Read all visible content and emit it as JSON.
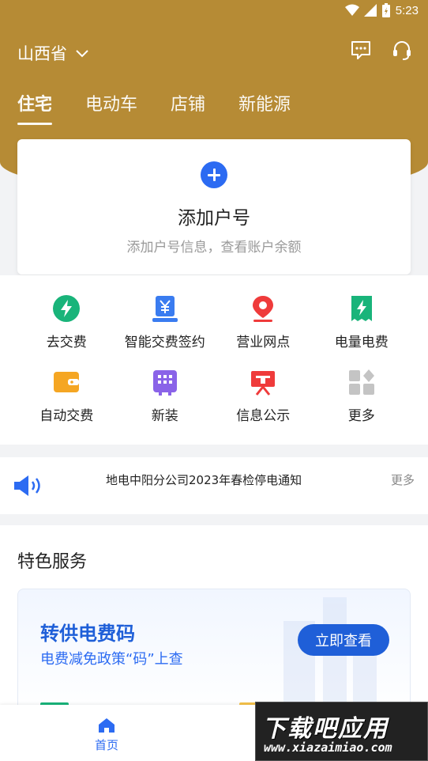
{
  "status_bar": {
    "time": "5:23"
  },
  "header": {
    "province": "山西省",
    "tabs": [
      {
        "label": "住宅",
        "active": true
      },
      {
        "label": "电动车",
        "active": false
      },
      {
        "label": "店铺",
        "active": false
      },
      {
        "label": "新能源",
        "active": false
      }
    ]
  },
  "account_card": {
    "title": "添加户号",
    "subtitle": "添加户号信息，查看账户余额"
  },
  "services": [
    {
      "label": "去交费",
      "icon": "lightning-circle-icon"
    },
    {
      "label": "智能交费签约",
      "icon": "yuan-sign-icon"
    },
    {
      "label": "营业网点",
      "icon": "location-pin-icon"
    },
    {
      "label": "电量电费",
      "icon": "bill-lightning-icon"
    },
    {
      "label": "自动交费",
      "icon": "wallet-icon"
    },
    {
      "label": "新装",
      "icon": "meter-grid-icon"
    },
    {
      "label": "信息公示",
      "icon": "notice-board-icon"
    },
    {
      "label": "更多",
      "icon": "more-grid-icon"
    }
  ],
  "notice": {
    "text": "地电中阳分公司2023年春检停电通知",
    "more": "更多"
  },
  "featured": {
    "title": "特色服务",
    "promo": {
      "title": "转供电费码",
      "subtitle": "电费减免政策“码”上查",
      "button": "立即查看"
    }
  },
  "bottom_nav": {
    "home_label": "首页"
  },
  "watermark": {
    "big": "下载吧应用",
    "small": "www.xiazaimiao.com"
  },
  "colors": {
    "header": "#b68b35",
    "accent": "#2c6bf2",
    "promo_dark": "#1f5fd8"
  }
}
